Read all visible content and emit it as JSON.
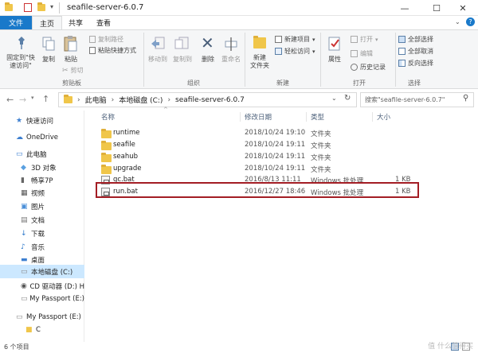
{
  "window": {
    "title": "seafile-server-6.0.7",
    "minimize": "—",
    "maximize": "☐",
    "close": "✕"
  },
  "ribbon_tabs": [
    "文件",
    "主页",
    "共享",
    "查看"
  ],
  "ribbon": {
    "clipboard": {
      "pin_label": "固定到\"快\n速访问\"",
      "copy_label": "复制",
      "paste_label": "粘贴",
      "cut_label": "剪切",
      "copy_path_label": "复制路径",
      "paste_shortcut_label": "粘贴快捷方式",
      "group_label": "剪贴板"
    },
    "organize": {
      "move_to_label": "移动到",
      "copy_to_label": "复制到",
      "delete_label": "删除",
      "rename_label": "重命名",
      "group_label": "组织"
    },
    "new": {
      "new_folder_label": "新建\n文件夹",
      "new_item_label": "新建项目",
      "easy_access_label": "轻松访问",
      "group_label": "新建"
    },
    "open": {
      "properties_label": "属性",
      "open_label": "打开",
      "edit_label": "编辑",
      "history_label": "历史记录",
      "group_label": "打开"
    },
    "select": {
      "select_all_label": "全部选择",
      "select_none_label": "全部取消",
      "invert_label": "反向选择",
      "group_label": "选择"
    }
  },
  "address": {
    "crumbs": [
      "此电脑",
      "本地磁盘 (C:)",
      "seafile-server-6.0.7"
    ],
    "search_placeholder": "搜索\"seafile-server-6.0.7\""
  },
  "nav": [
    {
      "label": "快速访问",
      "icon": "star-icon"
    },
    {
      "label": "OneDrive",
      "icon": "cloud-icon"
    },
    {
      "label": "此电脑",
      "icon": "computer-icon"
    },
    {
      "label": "3D 对象",
      "icon": "cube-icon"
    },
    {
      "label": "畅享7P",
      "icon": "phone-icon"
    },
    {
      "label": "视频",
      "icon": "video-icon"
    },
    {
      "label": "图片",
      "icon": "picture-icon"
    },
    {
      "label": "文档",
      "icon": "document-icon"
    },
    {
      "label": "下载",
      "icon": "download-icon"
    },
    {
      "label": "音乐",
      "icon": "music-icon"
    },
    {
      "label": "桌面",
      "icon": "desktop-icon"
    },
    {
      "label": "本地磁盘 (C:)",
      "icon": "drive-icon"
    },
    {
      "label": "CD 驱动器 (D:) H",
      "icon": "cd-icon"
    },
    {
      "label": "My Passport (E:)",
      "icon": "drive-icon"
    },
    {
      "label": "My Passport (E:)",
      "icon": "drive-icon"
    },
    {
      "label": "C",
      "icon": "folder-icon"
    }
  ],
  "columns": {
    "name": "名称",
    "date": "修改日期",
    "type": "类型",
    "size": "大小"
  },
  "files": [
    {
      "name": "runtime",
      "date": "2018/10/24 19:10",
      "type": "文件夹",
      "size": "",
      "icon": "folder-icon"
    },
    {
      "name": "seafile",
      "date": "2018/10/24 19:11",
      "type": "文件夹",
      "size": "",
      "icon": "folder-icon"
    },
    {
      "name": "seahub",
      "date": "2018/10/24 19:11",
      "type": "文件夹",
      "size": "",
      "icon": "folder-icon"
    },
    {
      "name": "upgrade",
      "date": "2018/10/24 19:11",
      "type": "文件夹",
      "size": "",
      "icon": "folder-icon"
    },
    {
      "name": "gc.bat",
      "date": "2016/8/13 11:11",
      "type": "Windows 批处理",
      "size": "1 KB",
      "icon": "batch-file-icon"
    },
    {
      "name": "run.bat",
      "date": "2016/12/27 18:46",
      "type": "Windows 批处理",
      "size": "1 KB",
      "icon": "batch-file-icon"
    }
  ],
  "status": {
    "count": "6 个项目"
  },
  "watermark": "值 什么值得买"
}
